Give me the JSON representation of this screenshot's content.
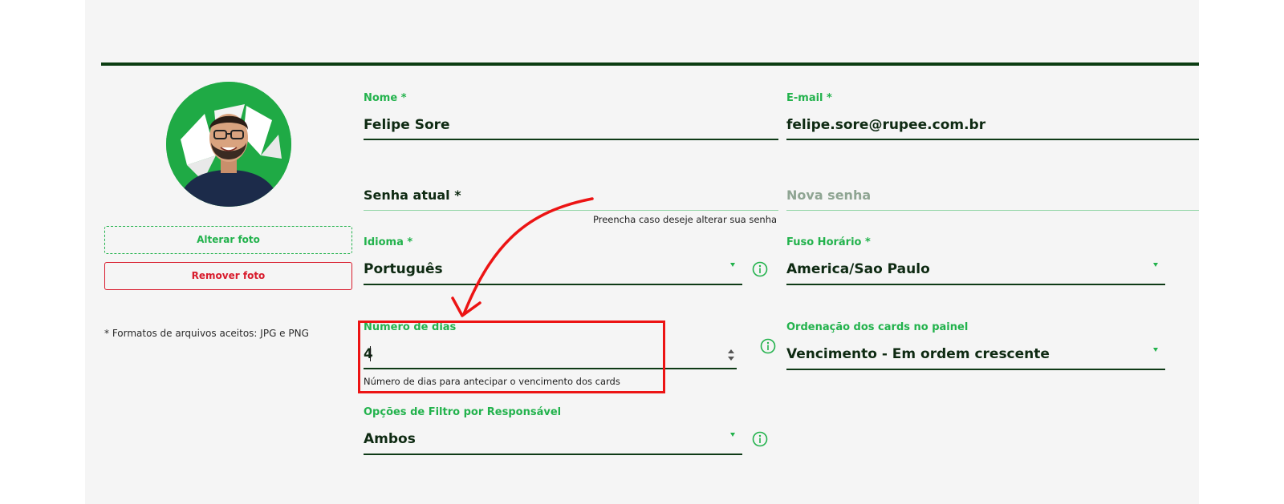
{
  "photo": {
    "change_label": "Alterar foto",
    "remove_label": "Remover foto",
    "formats_note": "* Formatos de arquivos aceitos: JPG e PNG"
  },
  "form": {
    "name": {
      "label": "Nome *",
      "value": "Felipe Sore"
    },
    "email": {
      "label": "E-mail *",
      "value": "felipe.sore@rupee.com.br"
    },
    "current_password": {
      "label": "Senha atual *",
      "hint": "Preencha caso deseje alterar sua senha"
    },
    "new_password": {
      "label": "Nova senha"
    },
    "language": {
      "label": "Idioma *",
      "value": "Português"
    },
    "timezone": {
      "label": "Fuso Horário *",
      "value": "America/Sao Paulo"
    },
    "days": {
      "label": "Número de dias",
      "value": "4",
      "hint": "Número de dias para antecipar o vencimento dos cards"
    },
    "card_order": {
      "label": "Ordenação dos cards no painel",
      "value": "Vencimento - Em ordem crescente"
    },
    "filter": {
      "label": "Opções de Filtro por Responsável",
      "value": "Ambos"
    }
  },
  "colors": {
    "accent_green": "#22b24c",
    "dark_green": "#0e3a16",
    "danger_red": "#d81b2c",
    "annotation_red": "#ec1414"
  },
  "icons": [
    "info-icon",
    "dropdown-caret-icon",
    "number-spinner-icon",
    "annotation-arrow"
  ]
}
